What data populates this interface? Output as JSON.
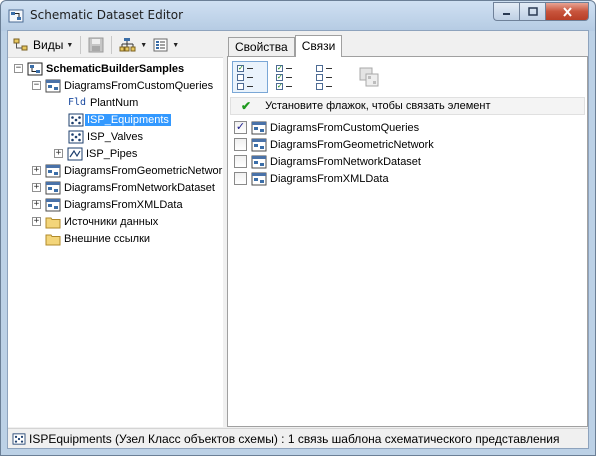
{
  "window": {
    "title": "Schematic Dataset Editor",
    "min_icon": "minimize-icon",
    "max_icon": "maximize-icon",
    "close_icon": "close-icon"
  },
  "left_toolbar": {
    "views_label": "Виды"
  },
  "tree": {
    "root": "SchematicBuilderSamples",
    "custom_queries": "DiagramsFromCustomQueries",
    "plant_num_prefix": "Fld",
    "plant_num": "PlantNum",
    "isp_equipments": "ISP_Equipments",
    "isp_valves": "ISP_Valves",
    "isp_pipes": "ISP_Pipes",
    "geometric_network": "DiagramsFromGeometricNetwork",
    "network_dataset": "DiagramsFromNetworkDataset",
    "xml_data": "DiagramsFromXMLData",
    "data_sources": "Источники данных",
    "external_links": "Внешние ссылки"
  },
  "tabs": [
    {
      "label": "Свойства",
      "active": false
    },
    {
      "label": "Связи",
      "active": true
    }
  ],
  "relations": {
    "hint": "Установите флажок, чтобы связать элемент",
    "items": [
      {
        "label": "DiagramsFromCustomQueries",
        "checked": true
      },
      {
        "label": "DiagramsFromGeometricNetwork",
        "checked": false
      },
      {
        "label": "DiagramsFromNetworkDataset",
        "checked": false
      },
      {
        "label": "DiagramsFromXMLData",
        "checked": false
      }
    ]
  },
  "status": {
    "text": "ISPEquipments (Узел Класс объектов схемы) : 1 связь шаблона схематического представления"
  },
  "colors": {
    "selection": "#3399ff",
    "title_bar": "#bcd1e6",
    "close_button": "#c8543c",
    "check_green": "#1f9a1f"
  }
}
